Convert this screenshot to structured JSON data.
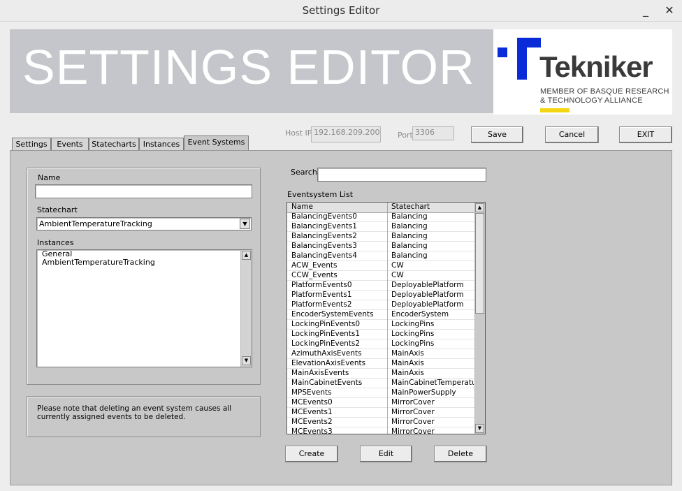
{
  "window": {
    "title": "Settings Editor",
    "minimize_glyph": "_",
    "close_glyph": "✕"
  },
  "banner": {
    "text": "SETTINGS EDITOR"
  },
  "logo": {
    "word": "Tekniker",
    "line1": "MEMBER OF BASQUE RESEARCH",
    "line2": "& TECHNOLOGY ALLIANCE",
    "brand_blue": "#0a2bd8",
    "brand_yellow": "#f5d614"
  },
  "connection": {
    "host_label": "Host IP",
    "host_value": "192.168.209.200",
    "port_label": "Port",
    "port_value": "3306"
  },
  "toolbar": {
    "save_label": "Save",
    "cancel_label": "Cancel",
    "exit_label": "EXIT"
  },
  "tabs": [
    {
      "label": "Settings"
    },
    {
      "label": "Events"
    },
    {
      "label": "Statecharts"
    },
    {
      "label": "Instances"
    },
    {
      "label": "Event Systems"
    }
  ],
  "form": {
    "name_label": "Name",
    "name_value": "",
    "statechart_label": "Statechart",
    "statechart_value": "AmbientTemperatureTracking",
    "instances_label": "Instances",
    "instances": [
      "General",
      "AmbientTemperatureTracking"
    ]
  },
  "note": {
    "text": "Please note that deleting an event system causes all currently assigned events to be deleted."
  },
  "search": {
    "label": "Search:",
    "value": ""
  },
  "list": {
    "title": "Eventsystem List",
    "columns": [
      "Name",
      "Statechart"
    ],
    "rows": [
      [
        "BalancingEvents0",
        "Balancing"
      ],
      [
        "BalancingEvents1",
        "Balancing"
      ],
      [
        "BalancingEvents2",
        "Balancing"
      ],
      [
        "BalancingEvents3",
        "Balancing"
      ],
      [
        "BalancingEvents4",
        "Balancing"
      ],
      [
        "ACW_Events",
        "CW"
      ],
      [
        "CCW_Events",
        "CW"
      ],
      [
        "PlatformEvents0",
        "DeployablePlatform"
      ],
      [
        "PlatformEvents1",
        "DeployablePlatform"
      ],
      [
        "PlatformEvents2",
        "DeployablePlatform"
      ],
      [
        "EncoderSystemEvents",
        "EncoderSystem"
      ],
      [
        "LockingPinEvents0",
        "LockingPins"
      ],
      [
        "LockingPinEvents1",
        "LockingPins"
      ],
      [
        "LockingPinEvents2",
        "LockingPins"
      ],
      [
        "AzimuthAxisEvents",
        "MainAxis"
      ],
      [
        "ElevationAxisEvents",
        "MainAxis"
      ],
      [
        "MainAxisEvents",
        "MainAxis"
      ],
      [
        "MainCabinetEvents",
        "MainCabinetTemperature"
      ],
      [
        "MPSEvents",
        "MainPowerSupply"
      ],
      [
        "MCEvents0",
        "MirrorCover"
      ],
      [
        "MCEvents1",
        "MirrorCover"
      ],
      [
        "MCEvents2",
        "MirrorCover"
      ],
      [
        "MCEvents3",
        "MirrorCover"
      ]
    ]
  },
  "actions": {
    "create_label": "Create",
    "edit_label": "Edit",
    "delete_label": "Delete"
  }
}
